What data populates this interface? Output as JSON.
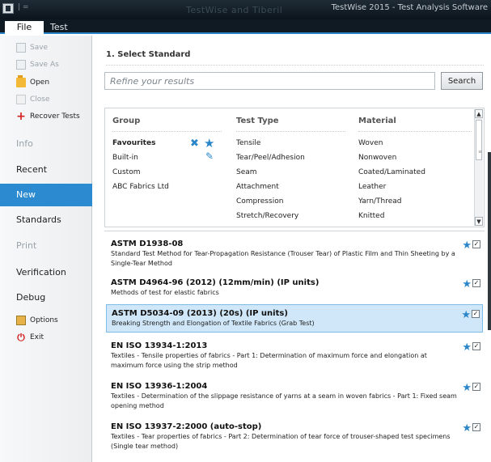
{
  "window": {
    "title": "TestWise 2015 - Test Analysis Software",
    "ghost_title": "TestWise and Tiberil",
    "qat": "| ="
  },
  "menu": {
    "file": "File",
    "test": "Test"
  },
  "sidebar": {
    "save": "Save",
    "save_as": "Save As",
    "open": "Open",
    "close": "Close",
    "recover": "Recover Tests",
    "info": "Info",
    "recent": "Recent",
    "new": "New",
    "standards": "Standards",
    "print": "Print",
    "verification": "Verification",
    "debug": "Debug",
    "options": "Options",
    "exit": "Exit"
  },
  "main": {
    "section_title": "1. Select Standard",
    "search_placeholder": "Refine your results",
    "search_button": "Search",
    "group_header": "Group",
    "type_header": "Test Type",
    "material_header": "Material",
    "groups": [
      "Favourites",
      "Built-in",
      "Custom",
      "ABC Fabrics Ltd"
    ],
    "test_types": [
      "Tensile",
      "Tear/Peel/Adhesion",
      "Seam",
      "Attachment",
      "Compression",
      "Stretch/Recovery"
    ],
    "materials": [
      "Woven",
      "Nonwoven",
      "Coated/Laminated",
      "Leather",
      "Yarn/Thread",
      "Knitted"
    ],
    "results": [
      {
        "code": "ASTM D1938-08",
        "desc": "Standard Test Method for Tear-Propagation Resistance (Trouser Tear) of Plastic Film and Thin Sheeting by a Single-Tear Method"
      },
      {
        "code": "ASTM D4964-96 (2012) (12mm/min) (IP units)",
        "desc": "Methods of test for elastic fabrics"
      },
      {
        "code": "ASTM D5034-09 (2013) (20s) (IP units)",
        "desc": "Breaking Strength and Elongation of Textile Fabrics (Grab Test)"
      },
      {
        "code": "EN ISO 13934-1:2013",
        "desc": "Textiles - Tensile properties of fabrics - Part 1: Determination of maximum force and elongation at maximum force using the strip method"
      },
      {
        "code": "EN ISO 13936-1:2004",
        "desc": "Textiles - Determination of the slippage resistance of yarns at a seam in woven fabrics - Part 1: Fixed seam opening method"
      },
      {
        "code": "EN ISO 13937-2:2000 (auto-stop)",
        "desc": "Textiles - Tear properties of fabrics - Part 2: Determination of tear force of trouser-shaped test specimens (Single tear method)"
      }
    ],
    "selected_index": 2
  },
  "colors": {
    "accent": "#2b8ad0",
    "selection": "#cfe7f8",
    "star": "#2a86c8",
    "exit": "#d21d1d"
  }
}
